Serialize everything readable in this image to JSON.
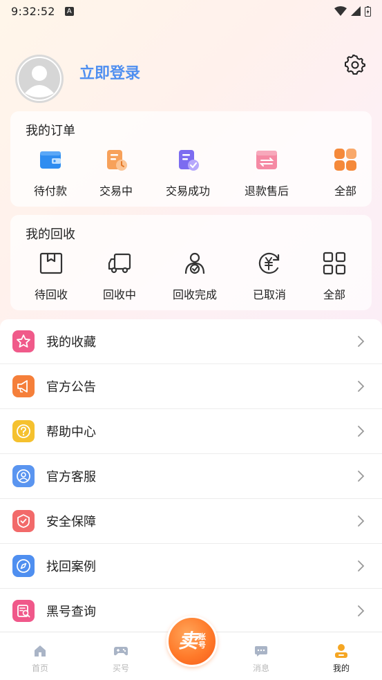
{
  "status_bar": {
    "time": "9:32:52",
    "notif_glyph": "A"
  },
  "profile": {
    "login_text": "立即登录"
  },
  "orders": {
    "title": "我的订单",
    "items": [
      {
        "label": "待付款",
        "icon": "wallet-icon"
      },
      {
        "label": "交易中",
        "icon": "trading-icon"
      },
      {
        "label": "交易成功",
        "icon": "success-icon"
      },
      {
        "label": "退款售后",
        "icon": "refund-icon"
      },
      {
        "label": "全部",
        "icon": "grid-icon"
      }
    ]
  },
  "recycle": {
    "title": "我的回收",
    "items": [
      {
        "label": "待回收",
        "icon": "box-icon"
      },
      {
        "label": "回收中",
        "icon": "truck-icon"
      },
      {
        "label": "回收完成",
        "icon": "person-check-icon"
      },
      {
        "label": "已取消",
        "icon": "yen-cancel-icon"
      },
      {
        "label": "全部",
        "icon": "grid-outline-icon"
      }
    ]
  },
  "menu": [
    {
      "label": "我的收藏",
      "icon": "star-icon",
      "color": "#f05a8a"
    },
    {
      "label": "官方公告",
      "icon": "megaphone-icon",
      "color": "#f57f3a"
    },
    {
      "label": "帮助中心",
      "icon": "question-icon",
      "color": "#f5c12e"
    },
    {
      "label": "官方客服",
      "icon": "user-service-icon",
      "color": "#5a95f0"
    },
    {
      "label": "安全保障",
      "icon": "shield-check-icon",
      "color": "#f26a6a"
    },
    {
      "label": "找回案例",
      "icon": "compass-icon",
      "color": "#4f8ff0"
    },
    {
      "label": "黑号查询",
      "icon": "search-doc-icon",
      "color": "#f0588a"
    }
  ],
  "bottom_nav": {
    "items": [
      {
        "label": "首页",
        "icon": "home-icon"
      },
      {
        "label": "买号",
        "icon": "gamepad-icon"
      },
      {
        "label": "消息",
        "icon": "message-icon"
      },
      {
        "label": "我的",
        "icon": "profile-icon",
        "active": true
      }
    ],
    "sell": {
      "big": "卖",
      "small_top": "账",
      "small_bottom": "号"
    }
  },
  "colors": {
    "accent_blue": "#4f8ff0",
    "sell_orange": "#ff7a2a",
    "active_nav": "#f5a623"
  }
}
